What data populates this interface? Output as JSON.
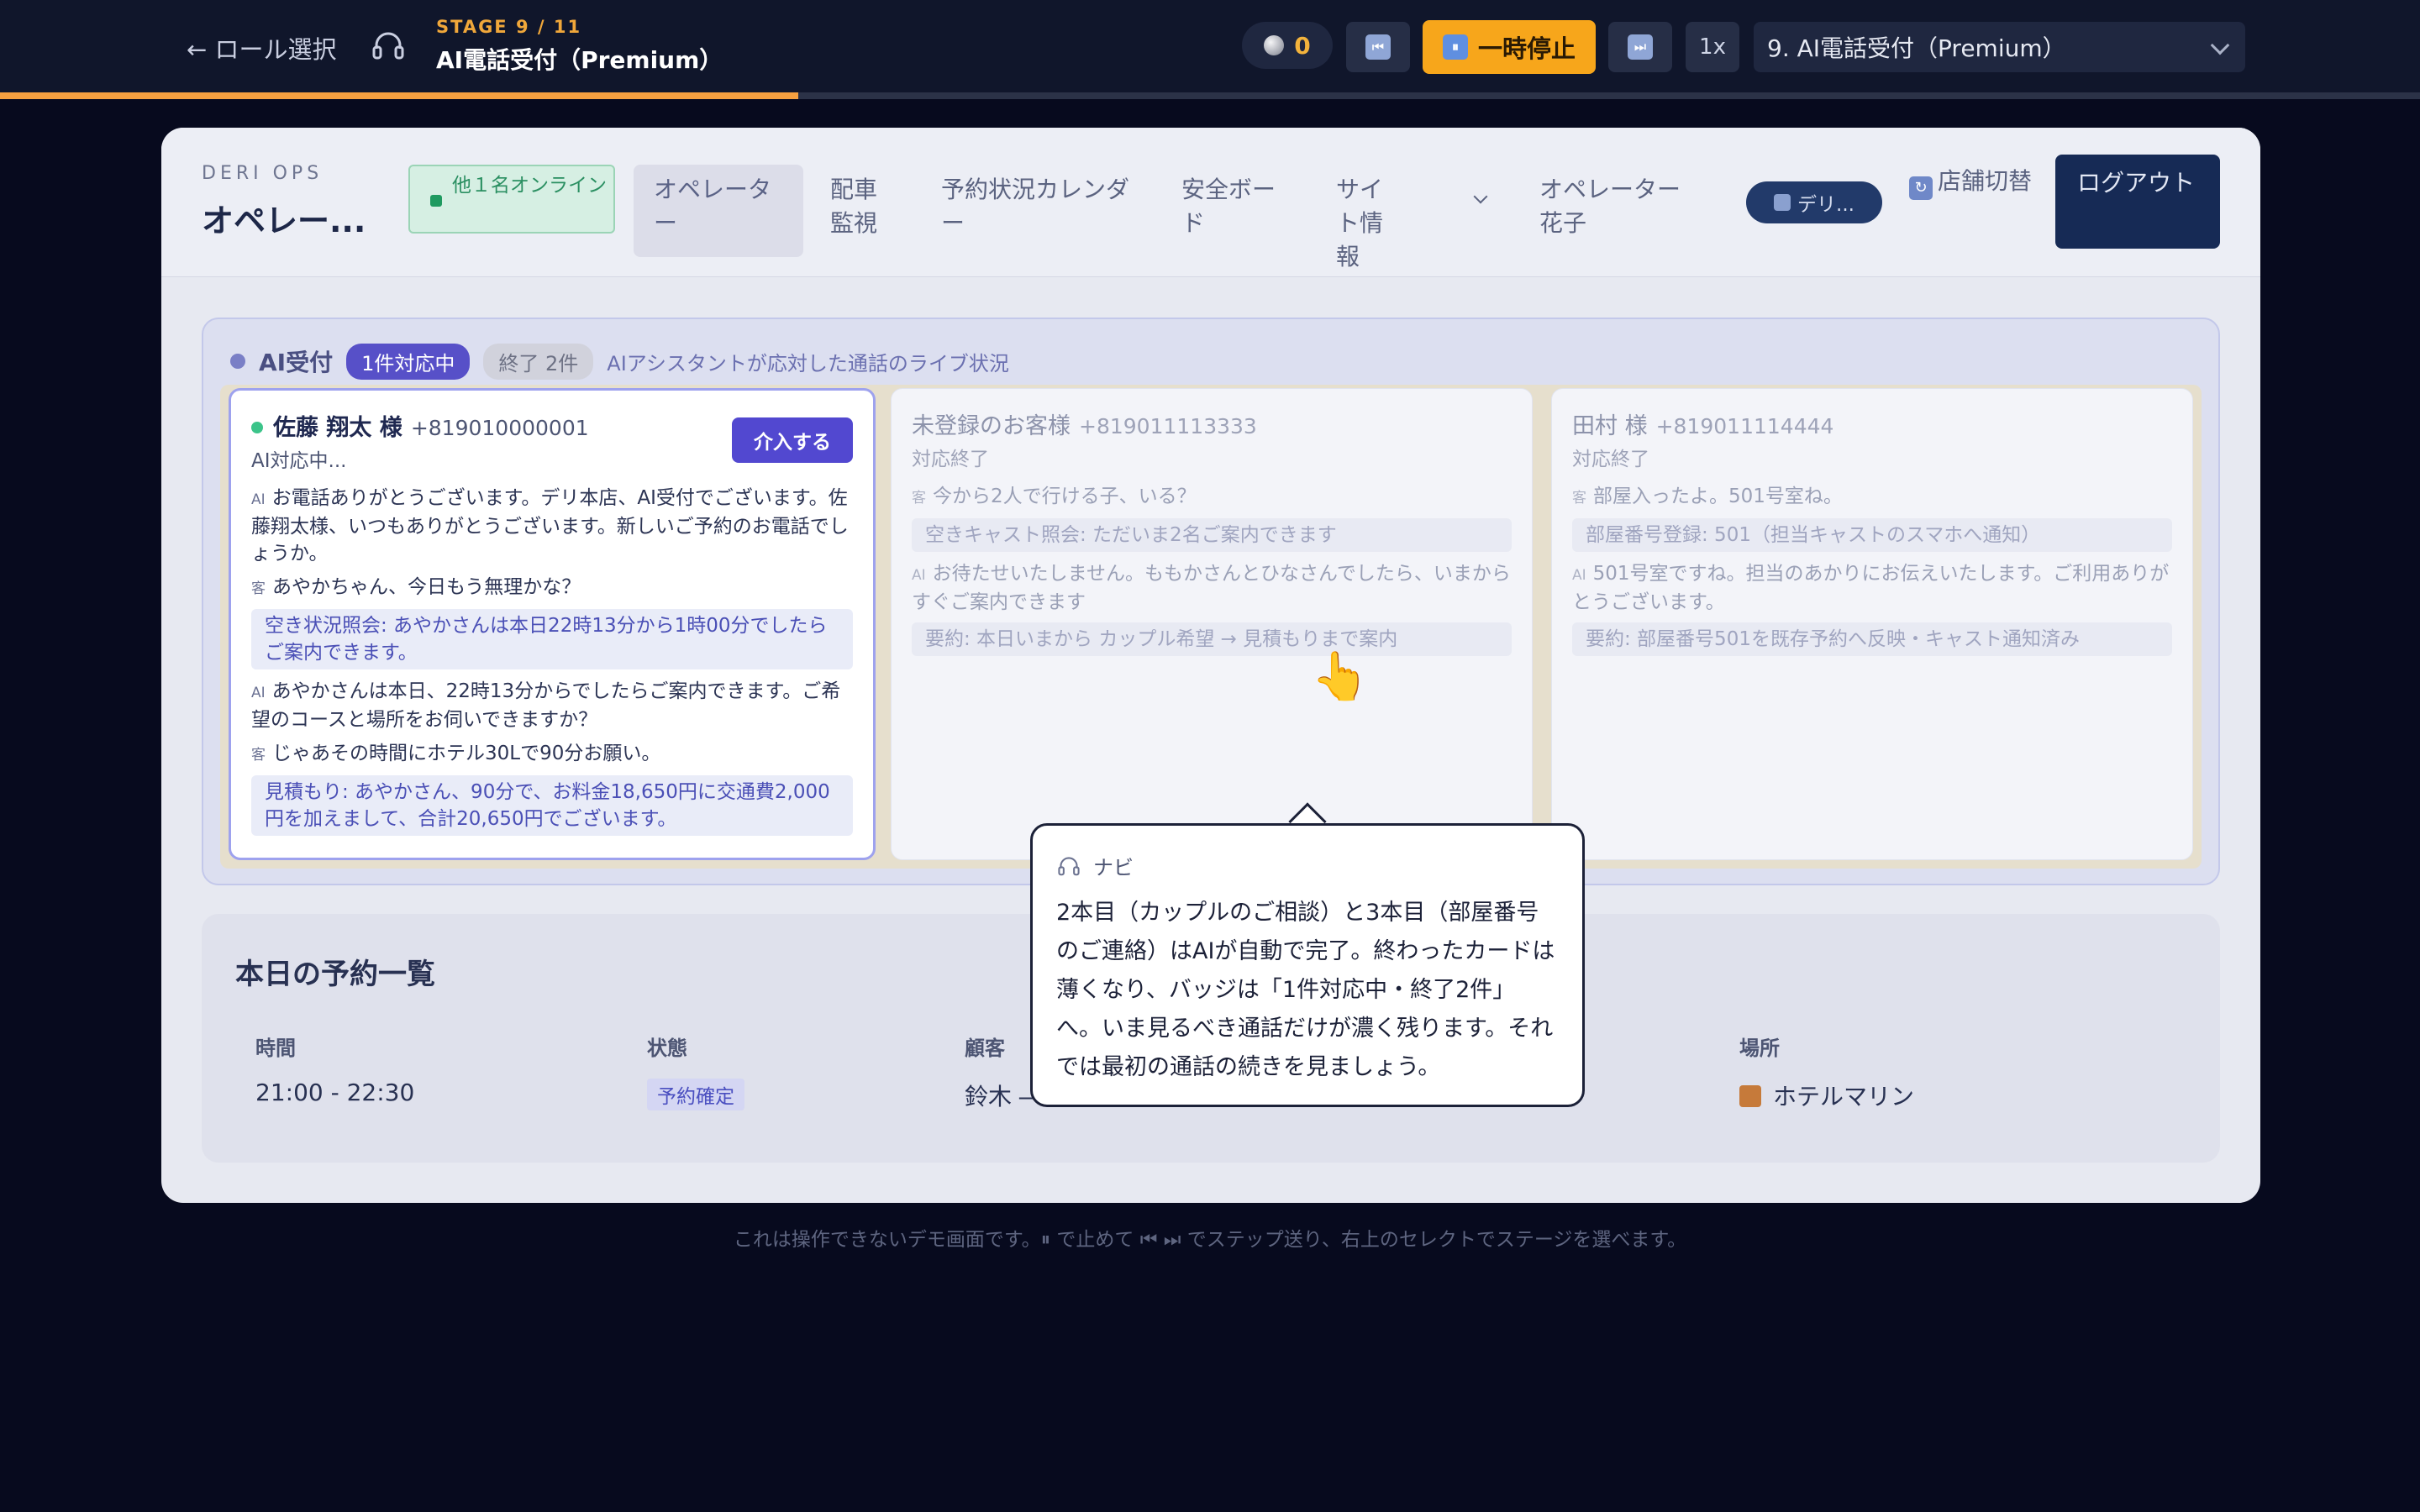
{
  "topbar": {
    "back_label": "← ロール選択",
    "stage_label": "STAGE 9 / 11",
    "stage_title": "AI電話受付（Premium）",
    "coin_count": "0",
    "rewind_label": "⏮",
    "pause_label": "一時停止",
    "pause_icon": "⏸",
    "forward_label": "⏭",
    "speed_label": "1x",
    "stage_select_value": "9. AI電話受付（Premium）",
    "progress_fraction": 0.33,
    "colors": {
      "accent": "#f7a61b",
      "bar": "#10162b"
    }
  },
  "header": {
    "brand_sub": "DERI OPS",
    "brand_title": "オペレー...",
    "online_badge": "他１名オンライン",
    "nav": [
      {
        "label": "オペレーター"
      },
      {
        "label": "配車監視"
      },
      {
        "label": "予約状況カレンダー"
      },
      {
        "label": "安全ボード"
      },
      {
        "label": "サイト情報"
      },
      {
        "label": "オペレーター 花子"
      }
    ],
    "user_chip": "デリ...",
    "store_switch": "店舗切替",
    "logout_label": "ログアウト"
  },
  "ai_panel": {
    "title": "AI受付",
    "badge_active": "1件対応中",
    "badge_done": "終了 2件",
    "description": "AIアシスタントが応対した通話のライブ状況",
    "intervene_label": "介入する",
    "speaker_ai": "AI",
    "speaker_customer": "客",
    "cards": [
      {
        "name": "佐藤 翔太 様",
        "phone": "+819010000001",
        "status": "AI対応中...",
        "lines": [
          {
            "type": "ai",
            "text": "お電話ありがとうございます。デリ本店、AI受付でございます。佐藤翔太様、いつもありがとうございます。新しいご予約のお電話でしょうか。"
          },
          {
            "type": "customer",
            "text": "あやかちゃん、今日もう無理かな？"
          },
          {
            "type": "system",
            "text": "空き状況照会: あやかさんは本日22時13分から1時00分でしたらご案内できます。"
          },
          {
            "type": "ai",
            "text": "あやかさんは本日、22時13分からでしたらご案内できます。ご希望のコースと場所をお伺いできますか？"
          },
          {
            "type": "customer",
            "text": "じゃあその時間にホテル30Lで90分お願い。"
          },
          {
            "type": "system",
            "text": "見積もり: あやかさん、90分で、お料金18,650円に交通費2,000円を加えまして、合計20,650円でございます。"
          }
        ]
      },
      {
        "name": "未登録のお客様",
        "phone": "+819011113333",
        "status": "対応終了",
        "lines": [
          {
            "type": "customer",
            "text": "今から2人で行ける子、いる？"
          },
          {
            "type": "system",
            "text": "空きキャスト照会: ただいま2名ご案内できます"
          },
          {
            "type": "ai",
            "text": "お待たせいたしません。ももかさんとひなさんでしたら、いまからすぐご案内できます"
          },
          {
            "type": "system",
            "text": "要約: 本日いまから カップル希望 → 見積もりまで案内"
          }
        ]
      },
      {
        "name": "田村 様",
        "phone": "+819011114444",
        "status": "対応終了",
        "lines": [
          {
            "type": "customer",
            "text": "部屋入ったよ。501号室ね。"
          },
          {
            "type": "system",
            "text": "部屋番号登録: 501（担当キャストのスマホへ通知）"
          },
          {
            "type": "ai",
            "text": "501号室ですね。担当のあかりにお伝えいたします。ご利用ありがとうございます。"
          },
          {
            "type": "system",
            "text": "要約: 部屋番号501を既存予約へ反映・キャスト通知済み"
          }
        ]
      }
    ]
  },
  "reservations": {
    "title": "本日の予約一覧",
    "columns": [
      "時間",
      "状態",
      "顧客",
      "場所"
    ],
    "rows": [
      {
        "time": "21:00 - 22:30",
        "status": "予約確定",
        "customer": "鈴木 ―",
        "place": "ホテルマリン"
      }
    ]
  },
  "tooltip": {
    "head": "ナビ",
    "body": "2本目（カップルのご相談）と3本目（部屋番号のご連絡）はAIが自動で完了。終わったカードは薄くなり、バッジは「1件対応中・終了2件」へ。いま見るべき通話だけが濃く残ります。それでは最初の通話の続きを見ましょう。"
  },
  "footer": {
    "note": "これは操作できないデモ画面です。⏸ で止めて ⏮ ⏭ でステップ送り、右上のセレクトでステージを選べます。"
  }
}
